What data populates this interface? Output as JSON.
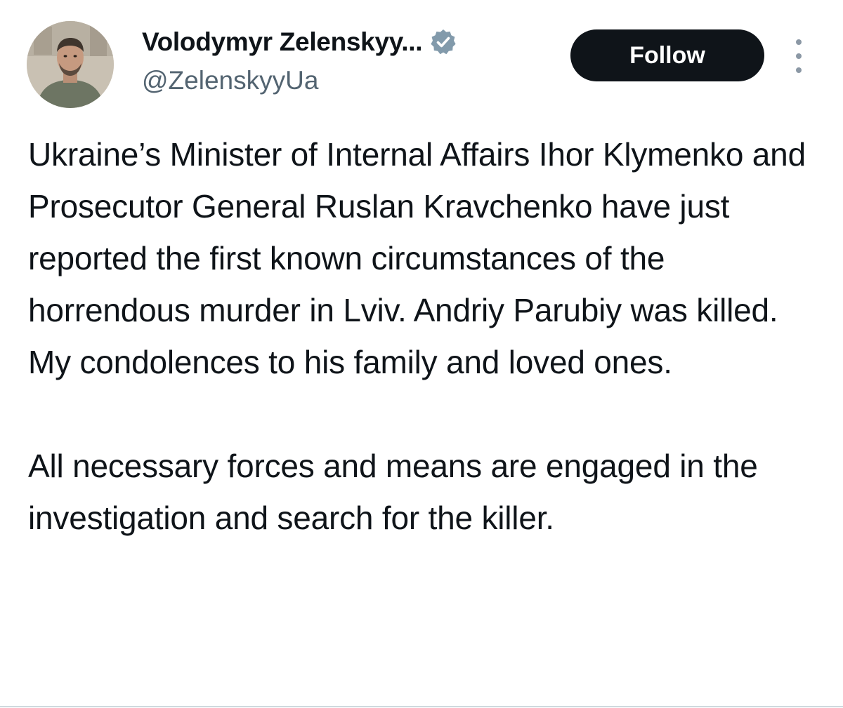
{
  "author": {
    "display_name": "Volodymyr Zelenskyy...",
    "handle": "@ZelenskyyUa",
    "verified_icon": "verified-badge-icon",
    "avatar_icon": "profile-avatar"
  },
  "actions": {
    "follow_label": "Follow",
    "more_icon": "vertical-ellipsis-icon"
  },
  "tweet": {
    "paragraphs": [
      "Ukraine’s Minister of Internal Affairs Ihor Klymenko and Prosecutor General Ruslan Kravchenko have just reported the first known circumstances of the horrendous murder in Lviv. Andriy Parubiy was killed. My condolences to his family and loved ones.",
      "All necessary forces and means are engaged in the investigation and search for the killer."
    ]
  },
  "colors": {
    "text": "#0f1419",
    "secondary": "#536471",
    "follow_bg": "#0f1419",
    "follow_text": "#ffffff",
    "verified": "#829aab"
  }
}
